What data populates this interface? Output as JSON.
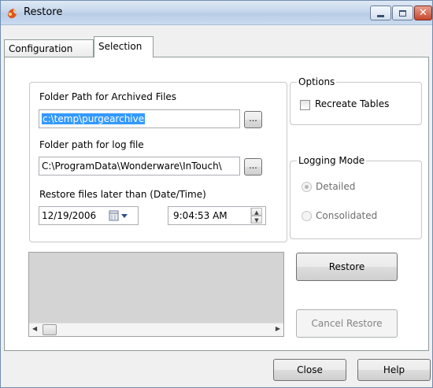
{
  "window": {
    "title": "Restore",
    "colors": {
      "titlebar": "#c6d7ec",
      "close_button": "#c7462c",
      "selection": "#3399ff"
    }
  },
  "tabs": [
    {
      "label": "Configuration",
      "active": false
    },
    {
      "label": "Selection",
      "active": true
    }
  ],
  "paths": {
    "archive_label": "Folder Path for Archived Files",
    "archive_value": "c:\\temp\\purgearchive",
    "archive_browse": "...",
    "log_label": "Folder path for log file",
    "log_value": "C:\\ProgramData\\Wonderware\\InTouch\\",
    "log_browse": "...",
    "date_label": "Restore files later than (Date/Time)",
    "date_value": "12/19/2006",
    "time_value": "9:04:53 AM"
  },
  "options": {
    "legend": "Options",
    "recreate_tables_label": "Recreate Tables",
    "recreate_tables_checked": false
  },
  "logging": {
    "legend": "Logging Mode",
    "detailed_label": "Detailed",
    "consolidated_label": "Consolidated",
    "selected": "Detailed",
    "enabled": false
  },
  "buttons": {
    "restore": "Restore",
    "cancel_restore": "Cancel Restore",
    "close": "Close",
    "help": "Help"
  },
  "icons": {
    "app": "restore-app-icon",
    "calendar": "calendar-icon",
    "spin": "spin-updown-icon"
  }
}
